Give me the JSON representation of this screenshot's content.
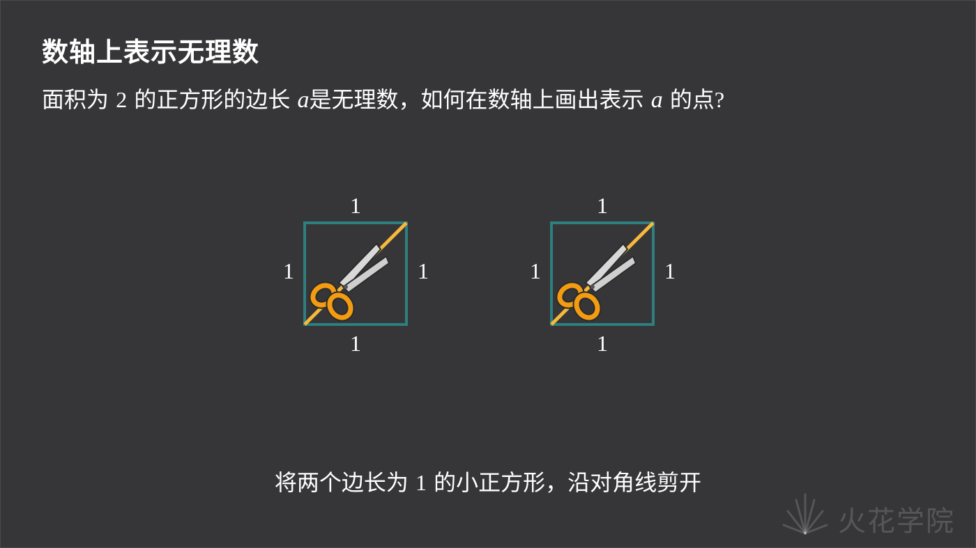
{
  "slide": {
    "title": "数轴上表示无理数",
    "question": {
      "part1": "面积为",
      "num": "2",
      "part2": "的正方形的边长",
      "var1": "a",
      "part3": "是无理数，如何在数轴上画出表示",
      "var2": "a",
      "part4": "的点",
      "qmark": "?"
    },
    "caption": {
      "part1": "将两个边长为",
      "num": "1",
      "part2": "的小正方形，沿对角线剪开"
    }
  },
  "diagram": {
    "squares": [
      {
        "top": "1",
        "left": "1",
        "right": "1",
        "bottom": "1"
      },
      {
        "top": "1",
        "left": "1",
        "right": "1",
        "bottom": "1"
      }
    ],
    "colors": {
      "square_stroke": "#2e7f7f",
      "diagonal": "#f6b93b",
      "scissor_handle": "#f39c12",
      "scissor_blade": "#d8d8d8"
    },
    "icons": [
      "scissors-icon"
    ]
  },
  "watermark": {
    "text": "火花学院"
  }
}
